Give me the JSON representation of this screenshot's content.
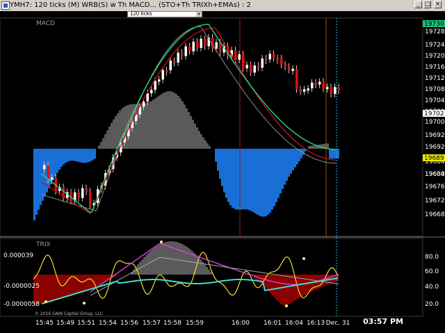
{
  "window": {
    "title": "YMH7: 120 ticks (M)  WRB(S) w Th MACD...  (STO+Th TRIXh+EMAs) : 2",
    "minimize_label": "_",
    "maximize_label": "□",
    "close_label": "×"
  },
  "toolbar": {
    "interval_select": "120 ticks",
    "arrow": "▾"
  },
  "panels": {
    "macd_label": "MACD",
    "trix_label": "TRIX",
    "copyright": "© 2016 GAIN Capital Group, LLC"
  },
  "price_axis": {
    "labels": [
      "19728",
      "19724",
      "19720",
      "19716",
      "19712",
      "19708",
      "19704",
      "19700",
      "19696",
      "19692",
      "19688",
      "19684",
      "19680",
      "19676",
      "19672",
      "19668"
    ],
    "current_top": "19730",
    "current_top_color": "#1fbf7a",
    "current_mid": "19702",
    "current_low": "19689",
    "current_low_color": "#f2e600"
  },
  "trix_axis": {
    "left_labels": [
      "0.000039",
      "-0.0000025",
      "-0.0000058"
    ],
    "right_labels": [
      "80.0",
      "60.0",
      "40.0",
      "20.0"
    ]
  },
  "time_axis": {
    "labels": [
      "15:45",
      "15:49",
      "15:51",
      "15:54",
      "15:56",
      "15:57",
      "15:58",
      "15:59",
      "16:00",
      "16:01",
      "16:04",
      "16:13",
      "Dec. 31"
    ]
  },
  "clock": "03:57 PM",
  "colors": {
    "candle_up": "#ffffff",
    "candle_down": "#e01010",
    "macd_positive": "#5a5a5a",
    "macd_negative": "#1a6fd6",
    "trix_fill": "#8b0000",
    "ema_green": "#30d08a",
    "ema_red": "#c01010",
    "sto_yellow": "#f0e030",
    "trix_cyan": "#40e0d0",
    "trix_magenta": "#e040e0",
    "cursor_cyan": "#30c0e0"
  }
}
